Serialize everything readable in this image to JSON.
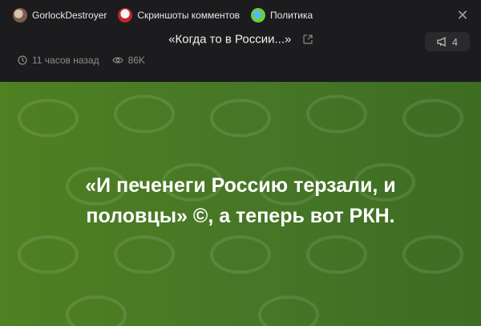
{
  "breadcrumbs": [
    {
      "label": "GorlockDestroyer",
      "icon": "user-avatar"
    },
    {
      "label": "Скриншоты комментов",
      "icon": "community-avatar"
    },
    {
      "label": "Политика",
      "icon": "politics-avatar"
    }
  ],
  "post": {
    "title": "«Когда то в России...»",
    "bookmarks": "4",
    "time": "11 часов назад",
    "views": "86K"
  },
  "banner": {
    "quote": "«И печенеги Россию терзали, и половцы» ©, а теперь вот РКН.",
    "bg_color": "#4b7d24"
  }
}
